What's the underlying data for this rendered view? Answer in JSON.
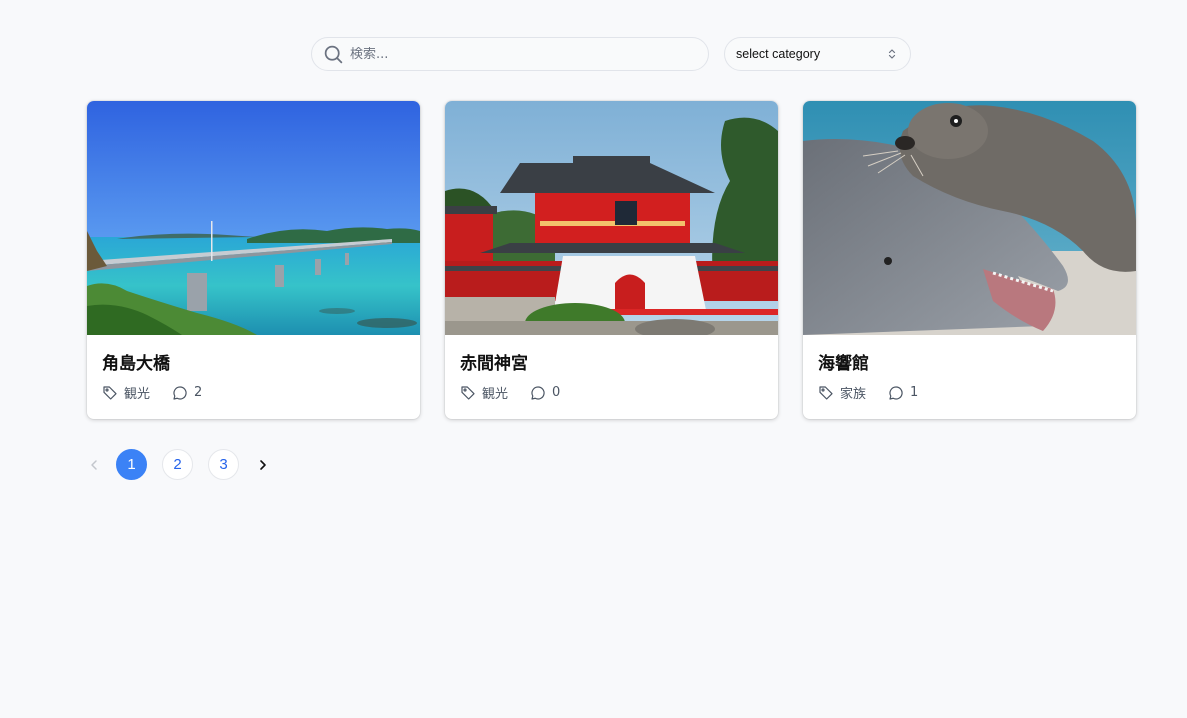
{
  "search": {
    "placeholder": "検索..."
  },
  "category_select": {
    "value": "select category"
  },
  "cards": [
    {
      "title": "角島大橋",
      "category": "観光",
      "comments": "2",
      "photo": "bridge-over-turquoise-sea"
    },
    {
      "title": "赤間神宮",
      "category": "観光",
      "comments": "0",
      "photo": "red-shrine-gate"
    },
    {
      "title": "海響館",
      "category": "家族",
      "comments": "1",
      "photo": "sea-lion-and-dolphin"
    }
  ],
  "pagination": {
    "pages": [
      "1",
      "2",
      "3"
    ],
    "current": "1"
  },
  "colors": {
    "accent": "#3b82f6",
    "link": "#2563eb",
    "background": "#f8f9fb"
  },
  "icons": [
    "search-icon",
    "chevron-updown-icon",
    "tag-icon",
    "comment-icon",
    "chevron-left-icon",
    "chevron-right-icon"
  ]
}
